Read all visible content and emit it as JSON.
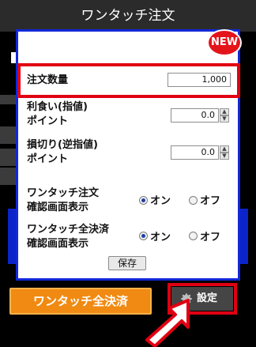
{
  "header": {
    "title": "ワンタッチ注文"
  },
  "dialog": {
    "badge": "NEW",
    "quantity": {
      "label": "注文数量",
      "value": "1,000"
    },
    "profit": {
      "label_line1": "利食い(指値)",
      "label_line2": "ポイント",
      "value": "0.0"
    },
    "loss": {
      "label_line1": "損切り(逆指値)",
      "label_line2": "ポイント",
      "value": "0.0"
    },
    "confirm_order": {
      "label_line1": "ワンタッチ注文",
      "label_line2": "確認画面表示",
      "on_label": "オン",
      "off_label": "オフ",
      "selected": "on"
    },
    "confirm_close": {
      "label_line1": "ワンタッチ全決済",
      "label_line2": "確認画面表示",
      "on_label": "オン",
      "off_label": "オフ",
      "selected": "on"
    },
    "save_label": "保存"
  },
  "footer": {
    "close_all_label": "ワンタッチ全決済",
    "settings_label": "設定",
    "settings_icon": "gear-icon"
  },
  "colors": {
    "dialog_border": "#1228d8",
    "highlight": "#e00012",
    "orange": "#f18a12",
    "badge": "#e4141b"
  }
}
